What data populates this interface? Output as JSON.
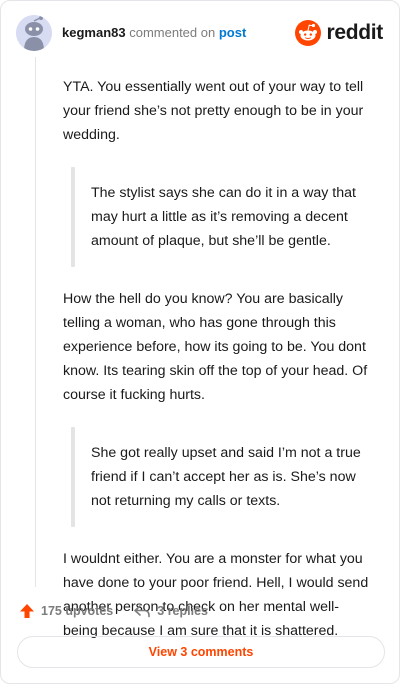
{
  "header": {
    "username": "kegman83",
    "verb": "commented on",
    "post_link": "post",
    "brand": "reddit"
  },
  "comment": {
    "paragraphs": [
      "YTA. You essentially went out of your way to tell your friend she’s not pretty enough to be in your wedding.",
      "How the hell do you know? You are basically telling a woman, who has gone through this experience before, how its going to be. You dont know. Its tearing skin off the top of your head. Of course it fucking hurts.",
      "I wouldnt either. You are a monster for what you have done to your poor friend. Hell, I would send another person to check on her mental well-being because I am sure that it is shattered."
    ],
    "quotes": [
      "The stylist says she can do it in a way that may hurt a little as it’s removing a decent amount of plaque, but she’ll be gentle.",
      "She got really upset and said I’m not a true friend if I can’t accept her as is. She’s now not returning my calls or texts."
    ]
  },
  "footer": {
    "upvotes": "175 upvotes",
    "replies": "3 replies",
    "view_comments": "View 3 comments"
  },
  "colors": {
    "accent": "#ff4500",
    "link": "#0079d3",
    "muted": "#7c7c7c"
  },
  "icons": [
    "avatar-icon",
    "reddit-logo-icon",
    "upvote-arrow-icon",
    "reply-arrow-icon"
  ]
}
